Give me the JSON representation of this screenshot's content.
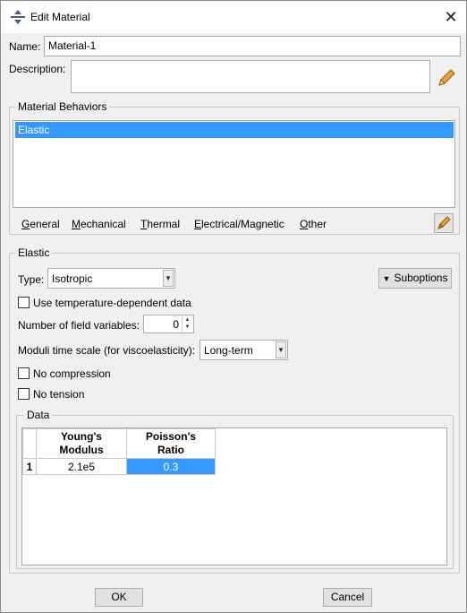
{
  "window": {
    "title": "Edit Material",
    "close_glyph": "✕",
    "app_icon": "abaqus-app-icon"
  },
  "name_row": {
    "label": "Name:",
    "value": "Material-1"
  },
  "description_row": {
    "label": "Description:",
    "value": "",
    "edit_icon": "pencil-icon"
  },
  "behaviors": {
    "title": "Material Behaviors",
    "items": [
      "Elastic"
    ],
    "selected": "Elastic",
    "menus": [
      {
        "label": "General",
        "mnemonic": "G",
        "rest": "eneral"
      },
      {
        "label": "Mechanical",
        "mnemonic": "M",
        "rest": "echanical"
      },
      {
        "label": "Thermal",
        "mnemonic": "T",
        "rest": "hermal"
      },
      {
        "label": "Electrical/Magnetic",
        "mnemonic": "E",
        "rest": "lectrical/Magnetic"
      },
      {
        "label": "Other",
        "mnemonic": "O",
        "rest": "ther"
      }
    ],
    "tool_icon": "eraser-icon"
  },
  "elastic": {
    "title": "Elastic",
    "type_label": "Type:",
    "type_value": "Isotropic",
    "suboptions_label": "Suboptions",
    "temp_dependent_label": "Use temperature-dependent data",
    "temp_dependent_checked": false,
    "field_vars_label": "Number of field variables:",
    "field_vars_value": "0",
    "moduli_label": "Moduli time scale (for viscoelasticity):",
    "moduli_value": "Long-term",
    "no_compression_label": "No compression",
    "no_compression_checked": false,
    "no_tension_label": "No tension",
    "no_tension_checked": false
  },
  "data": {
    "title": "Data",
    "columns": [
      {
        "line1": "Young's",
        "line2": "Modulus"
      },
      {
        "line1": "Poisson's",
        "line2": "Ratio"
      }
    ],
    "rows": [
      {
        "index": "1",
        "values": [
          "2.1e5",
          "0.3"
        ]
      }
    ],
    "selected_color": "#3399ff"
  },
  "buttons": {
    "ok": "OK",
    "cancel": "Cancel"
  }
}
